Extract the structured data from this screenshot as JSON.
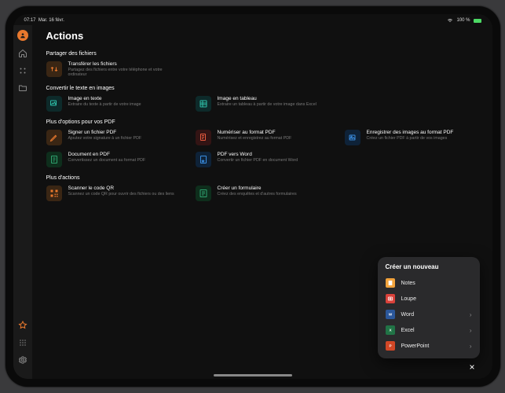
{
  "status": {
    "time": "07:17",
    "date": "Mar. 16 févr.",
    "battery": "100 %",
    "wifi": "wifi"
  },
  "header": {
    "title": "Actions"
  },
  "sections": [
    {
      "title": "Partager des fichiers",
      "items": [
        {
          "icon": "transfer",
          "color": "orange",
          "title": "Transférer les fichiers",
          "sub": "Partagez des fichiers entre votre téléphone et votre ordinateur"
        }
      ]
    },
    {
      "title": "Convertir le texte en images",
      "items": [
        {
          "icon": "image-text",
          "color": "teal",
          "title": "Image en texte",
          "sub": "Extraire du texte à partir de votre image"
        },
        {
          "icon": "image-table",
          "color": "teal",
          "title": "Image en tableau",
          "sub": "Extraire un tableau à partir de votre image dans Excel"
        }
      ]
    },
    {
      "title": "Plus d'options pour vos PDF",
      "items": [
        {
          "icon": "sign",
          "color": "orange",
          "title": "Signer un fichier PDF",
          "sub": "Ajoutez votre signature à un fichier PDF"
        },
        {
          "icon": "scan-pdf",
          "color": "red",
          "title": "Numériser au format PDF",
          "sub": "Numérisez et enregistrez au format PDF"
        },
        {
          "icon": "images-pdf",
          "color": "blue",
          "title": "Enregistrer des images au format PDF",
          "sub": "Créez un fichier PDF à partir de vos images"
        },
        {
          "icon": "doc-pdf",
          "color": "green",
          "title": "Document en PDF",
          "sub": "Convertissez un document au format PDF"
        },
        {
          "icon": "pdf-word",
          "color": "blue",
          "title": "PDF vers Word",
          "sub": "Convertir un fichier PDF en document Word"
        }
      ]
    },
    {
      "title": "Plus d'actions",
      "items": [
        {
          "icon": "qr",
          "color": "orange",
          "title": "Scanner le code QR",
          "sub": "Scannez un code QR pour ouvrir des fichiers ou des liens"
        },
        {
          "icon": "form",
          "color": "green",
          "title": "Créer un formulaire",
          "sub": "Créez des enquêtes et d'autres formulaires"
        }
      ]
    }
  ],
  "popup": {
    "title": "Créer un nouveau",
    "rows": [
      {
        "icon": "notes",
        "bg": "#f2a33c",
        "label": "Notes",
        "chev": false
      },
      {
        "icon": "lens",
        "bg": "#d9413a",
        "label": "Loupe",
        "chev": false
      },
      {
        "icon": "word",
        "bg": "#2b579a",
        "label": "Word",
        "chev": true
      },
      {
        "icon": "excel",
        "bg": "#217346",
        "label": "Excel",
        "chev": true
      },
      {
        "icon": "ppt",
        "bg": "#d24726",
        "label": "PowerPoint",
        "chev": true
      }
    ],
    "close": "×"
  }
}
